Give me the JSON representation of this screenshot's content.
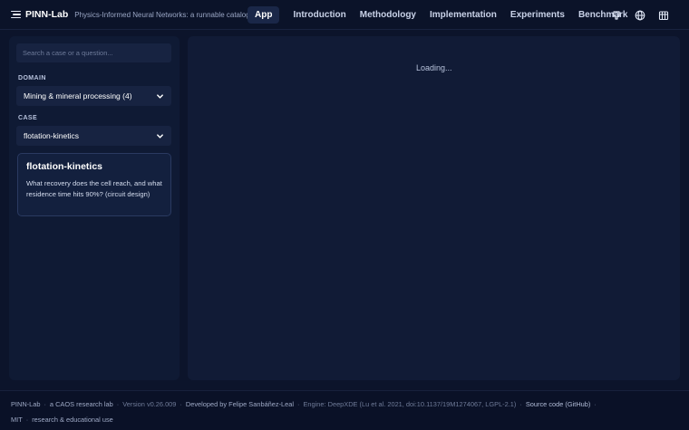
{
  "header": {
    "brand_name": "PINN-Lab",
    "tagline": "Physics-Informed Neural Networks: a runnable catalogue",
    "nav": [
      {
        "label": "App",
        "active": true
      },
      {
        "label": "Introduction"
      },
      {
        "label": "Methodology"
      },
      {
        "label": "Implementation"
      },
      {
        "label": "Experiments"
      },
      {
        "label": "Benchmark"
      }
    ],
    "icons": [
      "github-icon",
      "globe-icon",
      "bank-icon"
    ]
  },
  "sidebar": {
    "search_placeholder": "Search a case or a question...",
    "domain_label": "DOMAIN",
    "domain_value": "Mining & mineral processing (4)",
    "case_label": "CASE",
    "case_value": "flotation-kinetics",
    "card": {
      "title": "flotation-kinetics",
      "description": "What recovery does the cell reach, and what residence time hits 90%? (circuit design)"
    }
  },
  "main": {
    "status": "Loading..."
  },
  "footer": {
    "app": "PINN-Lab",
    "lab": "a CAOS research lab",
    "version": "Version v0.26.009",
    "developer": "Developed by Felipe Sanbáñez-Leal",
    "engine": "Engine: DeepXDE (Lu et al. 2021, doi:10.1137/19M1274067, LGPL-2.1)",
    "source": "Source code (GitHub)",
    "license": "MIT",
    "license_note": "research & educational use"
  },
  "colors": {
    "background": "#0c142b",
    "panel": "#111b36",
    "sidebar": "#0f1a34",
    "accent_active": "#1a2748"
  }
}
